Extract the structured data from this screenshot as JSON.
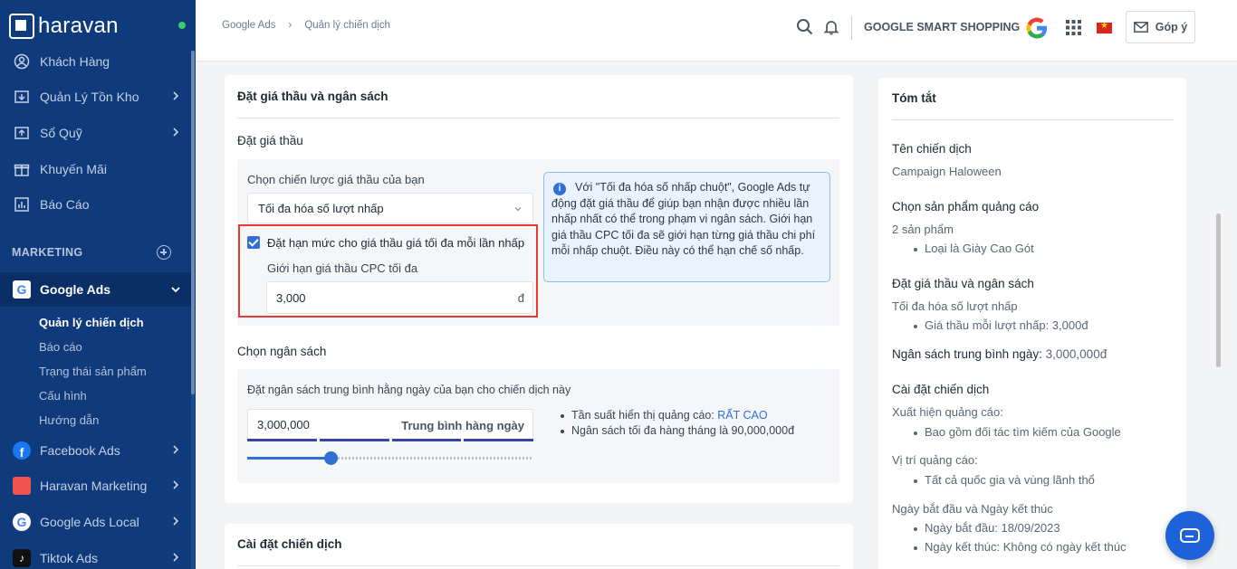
{
  "brand": {
    "name": "haravan"
  },
  "sidebar": {
    "items": [
      {
        "label": "Khách Hàng"
      },
      {
        "label": "Quản Lý Tồn Kho"
      },
      {
        "label": "Sổ Quỹ"
      },
      {
        "label": "Khuyến Mãi"
      },
      {
        "label": "Báo Cáo"
      }
    ],
    "section_label": "MARKETING",
    "google_ads": {
      "label": "Google Ads",
      "sub_items": [
        {
          "label": "Quản lý chiến dịch"
        },
        {
          "label": "Báo cáo"
        },
        {
          "label": "Trạng thái sản phẩm"
        },
        {
          "label": "Cấu hình"
        },
        {
          "label": "Hướng dẫn"
        }
      ]
    },
    "apps": [
      {
        "label": "Facebook Ads"
      },
      {
        "label": "Haravan Marketing"
      },
      {
        "label": "Google Ads Local"
      },
      {
        "label": "Tiktok Ads"
      }
    ]
  },
  "header": {
    "breadcrumb": [
      "Google Ads",
      "›",
      "Quản lý chiến dịch"
    ],
    "title": "GOOGLE SMART SHOPPING",
    "feedback_label": "Góp ý"
  },
  "bidding_card": {
    "title": "Đặt giá thầu và ngân sách",
    "bid_section_title": "Đặt giá thầu",
    "strategy_label": "Chọn chiến lược giá thầu của bạn",
    "strategy_value": "Tối đa hóa số lượt nhấp",
    "max_bid_checkbox_label": "Đặt hạn mức cho giá thầu giá tối đa mỗi lần nhấp",
    "max_bid_checked": true,
    "cpc_limit_label": "Giới hạn giá thầu CPC tối đa",
    "cpc_limit_value": "3,000",
    "currency": "đ",
    "info_text": "Với \"Tối đa hóa số nhấp chuột\", Google Ads tự động đặt giá thầu để giúp bạn nhận được nhiều lần nhấp nhất có thể trong phạm vi ngân sách. Giới hạn giá thầu CPC tối đa sẽ giới hạn từng giá thầu chi phí mỗi nhấp chuột. Điều này có thể hạn chế số nhấp.",
    "budget_section_title": "Chọn ngân sách",
    "budget_desc": "Đặt ngân sách trung bình hằng ngày của bạn cho chiến dịch này",
    "budget_value": "3,000,000",
    "budget_suffix": "Trung bình hàng ngày",
    "budget_slider_fraction": 0.29,
    "freq_label": "Tần suất hiển thị quảng cáo:",
    "freq_value": "RẤT CAO",
    "monthly_max": "Ngân sách tối đa hàng tháng là 90,000,000đ"
  },
  "campaign_card": {
    "title": "Cài đặt chiến dịch"
  },
  "summary": {
    "title": "Tóm tắt",
    "name_h": "Tên chiến dịch",
    "name_v": "Campaign Haloween",
    "product_h": "Chọn sản phẩm quảng cáo",
    "product_v": "2 sản phẩm",
    "product_li": "Loại là Giày Cao Gót",
    "bid_h": "Đặt giá thầu và ngân sách",
    "bid_v": "Tối đa hóa số lượt nhấp",
    "bid_li": "Giá thầu mỗi lượt nhấp: 3,000đ",
    "daily_h": "Ngân sách trung bình ngày:",
    "daily_v": "3,000,000đ",
    "settings_h": "Cài đặt chiến dịch",
    "appear_h": "Xuất hiện quảng cáo:",
    "appear_li": "Bao gồm đối tác tìm kiếm của Google",
    "location_h": "Vị trí quảng cáo:",
    "location_li": "Tất cả quốc gia và vùng lãnh thổ",
    "dates_h": "Ngày bắt đầu và Ngày kết thúc",
    "start_li": "Ngày bắt đầu: 18/09/2023",
    "end_li": "Ngày kết thúc: Không có ngày kết thúc"
  },
  "colors": {
    "sidebar_bg": "#0f3b7d",
    "accent": "#2f6fd6",
    "highlight_border": "#e53935"
  }
}
